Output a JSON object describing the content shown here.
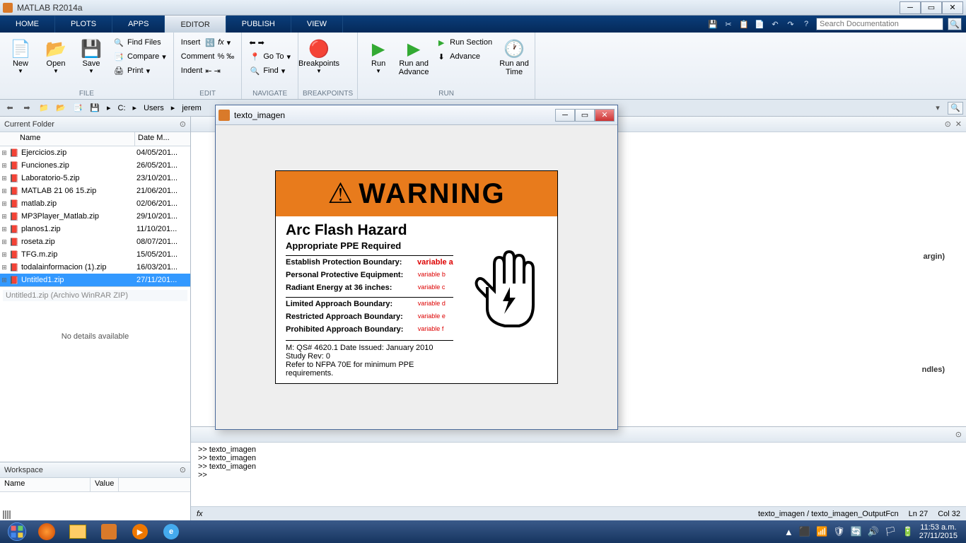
{
  "titlebar": {
    "title": "MATLAB R2014a"
  },
  "tabs": {
    "home": "HOME",
    "plots": "PLOTS",
    "apps": "APPS",
    "editor": "EDITOR",
    "publish": "PUBLISH",
    "view": "VIEW"
  },
  "searchdoc_placeholder": "Search Documentation",
  "ribbon": {
    "file": {
      "new": "New",
      "open": "Open",
      "save": "Save",
      "findfiles": "Find Files",
      "compare": "Compare",
      "print": "Print",
      "label": "FILE"
    },
    "edit": {
      "insert": "Insert",
      "comment": "Comment",
      "indent": "Indent",
      "label": "EDIT"
    },
    "nav": {
      "goto": "Go To",
      "find": "Find",
      "label": "NAVIGATE"
    },
    "bp": {
      "breakpoints": "Breakpoints",
      "label": "BREAKPOINTS"
    },
    "run": {
      "run": "Run",
      "runadv": "Run and\nAdvance",
      "runsec": "Run Section",
      "advance": "Advance",
      "runtime": "Run and\nTime",
      "label": "RUN"
    }
  },
  "path": {
    "c": "C:",
    "users": "Users",
    "user": "jerem"
  },
  "currentfolder": {
    "title": "Current Folder",
    "col_name": "Name",
    "col_date": "Date M...",
    "files": [
      {
        "name": "Ejercicios.zip",
        "date": "04/05/201..."
      },
      {
        "name": "Funciones.zip",
        "date": "26/05/201..."
      },
      {
        "name": "Laboratorio-5.zip",
        "date": "23/10/201..."
      },
      {
        "name": "MATLAB 21 06 15.zip",
        "date": "21/06/201..."
      },
      {
        "name": "matlab.zip",
        "date": "02/06/201..."
      },
      {
        "name": "MP3Player_Matlab.zip",
        "date": "29/10/201..."
      },
      {
        "name": "planos1.zip",
        "date": "11/10/201..."
      },
      {
        "name": "roseta.zip",
        "date": "08/07/201..."
      },
      {
        "name": "TFG.m.zip",
        "date": "15/05/201..."
      },
      {
        "name": "todalainformacion (1).zip",
        "date": "16/03/201..."
      },
      {
        "name": "Untitled1.zip",
        "date": "27/11/201..."
      }
    ],
    "selected": 10,
    "details_title": "Untitled1.zip (Archivo WinRAR ZIP)",
    "details_body": "No details available"
  },
  "workspace": {
    "title": "Workspace",
    "col_name": "Name",
    "col_value": "Value"
  },
  "editor": {
    "visible1": "argin)",
    "visible2": "ndles)"
  },
  "console": {
    "lines": [
      ">> texto_imagen",
      ">> texto_imagen",
      ">> texto_imagen",
      ">> "
    ],
    "fx": "fx"
  },
  "status": {
    "tab": "texto_imagen / texto_imagen_OutputFcn",
    "ln": "Ln  27",
    "col": "Col  32"
  },
  "figure": {
    "title": "texto_imagen",
    "warning": "WARNING",
    "h2": "Arc Flash Hazard",
    "h3": "Appropriate PPE Required",
    "rows1": [
      {
        "l": "Establish Protection Boundary:",
        "v": "variable a",
        "big": true
      },
      {
        "l": "Personal Protective Equipment:",
        "v": "variable b"
      },
      {
        "l": "Radiant Energy at 36 inches:",
        "v": "variable c"
      }
    ],
    "rows2": [
      {
        "l": "Limited Approach Boundary:",
        "v": "variable d"
      },
      {
        "l": "Restricted Approach Boundary:",
        "v": "variable e"
      },
      {
        "l": "Prohibited Approach Boundary:",
        "v": "variable f"
      }
    ],
    "foot1": "M: QS# 4620.1 Date Issued: January 2010 Study Rev: 0",
    "foot2": "Refer to NFPA 70E for minimum PPE requirements."
  },
  "taskbar": {
    "time": "11:53 a.m.",
    "date": "27/11/2015"
  }
}
